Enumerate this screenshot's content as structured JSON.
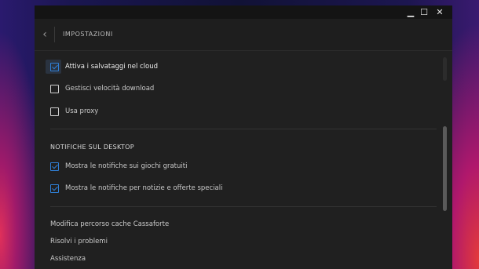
{
  "window": {
    "controls": {
      "minimize": "▁",
      "maximize": "☐",
      "close": "✕"
    }
  },
  "header": {
    "back_icon": "chevron-left",
    "title": "IMPOSTAZIONI"
  },
  "options": [
    {
      "label": "Attiva i salvataggi nel cloud",
      "checked": true
    },
    {
      "label": "Gestisci velocità download",
      "checked": false
    },
    {
      "label": "Usa proxy",
      "checked": false
    }
  ],
  "notifications": {
    "title": "NOTIFICHE SUL DESKTOP",
    "items": [
      {
        "label": "Mostra le notifiche sui giochi gratuiti",
        "checked": true
      },
      {
        "label": "Mostra le notifiche per notizie e offerte speciali",
        "checked": true
      }
    ]
  },
  "links": [
    "Modifica percorso cache Cassaforte",
    "Risolvi i problemi",
    "Assistenza"
  ],
  "colors": {
    "accent": "#2f7fd6",
    "panel": "#202020",
    "titlebar": "#141414"
  }
}
